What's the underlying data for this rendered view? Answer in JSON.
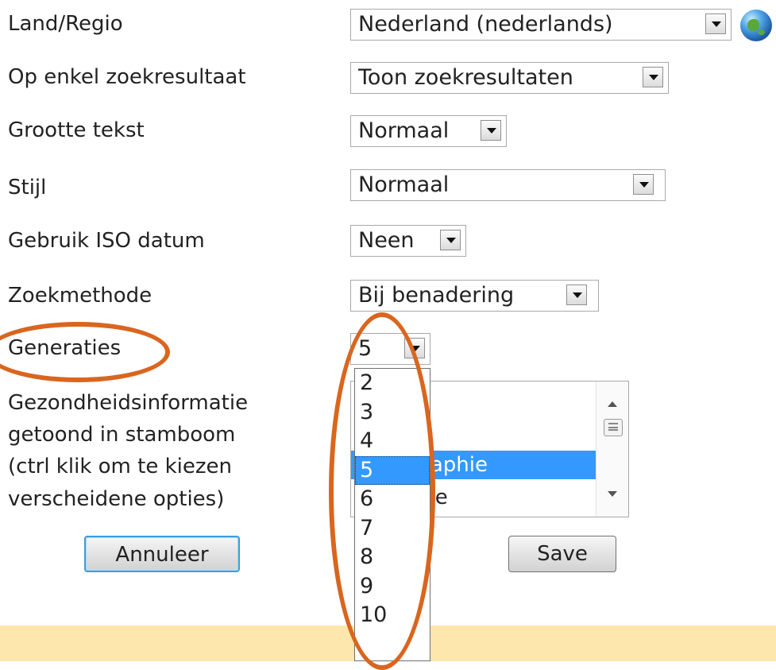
{
  "settings": {
    "rows": [
      {
        "label": "Land/Regio",
        "value": "Nederland (nederlands)"
      },
      {
        "label": "Op enkel zoekresultaat",
        "value": "Toon zoekresultaten"
      },
      {
        "label": "Grootte tekst",
        "value": "Normaal"
      },
      {
        "label": "Stijl",
        "value": "Normaal"
      },
      {
        "label": "Gebruik ISO datum",
        "value": "Neen"
      },
      {
        "label": "Zoekmethode",
        "value": "Bij benadering"
      },
      {
        "label": "Generaties",
        "value": "5"
      }
    ],
    "health": {
      "label_lines": [
        "Gezondheidsinformatie",
        "getoond in stamboom",
        "(ctrl klik om te kiezen",
        "verscheidene opties)"
      ],
      "visible_options": [
        "echographie",
        "autopsie"
      ],
      "selected": "echographie"
    }
  },
  "generations_dropdown": {
    "options": [
      "2",
      "3",
      "4",
      "5",
      "6",
      "7",
      "8",
      "9",
      "10"
    ],
    "selected": "5"
  },
  "buttons": {
    "cancel": "Annuleer",
    "save": "Save"
  },
  "icons": {
    "globe": "globe-icon"
  },
  "colors": {
    "annotation": "#d9661f",
    "selection": "#3399ff",
    "footer": "#fde7ad"
  }
}
